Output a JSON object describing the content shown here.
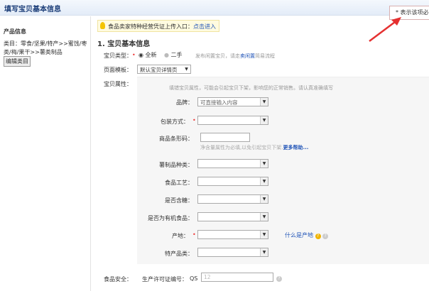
{
  "header": {
    "title": "填写宝贝基本信息"
  },
  "tooltip": {
    "text": "* 表示该项必"
  },
  "sidebar": {
    "heading": "产品信息",
    "category_line1": "类目：零食/坚果/特产>>蜜饯/枣",
    "category_line2": "类/梅/果干>>薯类制品",
    "edit_button": "编辑类目"
  },
  "notice": {
    "text": "食品卖家特种经营凭证上传入口：",
    "link": "点击进入"
  },
  "section": {
    "title": "1. 宝贝基本信息"
  },
  "type": {
    "label": "宝贝类型：",
    "opt_new": "全新",
    "opt_used": "二手",
    "hint": "发布闲置宝贝，请走",
    "hint_link": "卖闲置",
    "hint_tail": "简易流程"
  },
  "template": {
    "label": "页面模板：",
    "value": "默认宝贝详情页"
  },
  "attrs": {
    "label": "宝贝属性：",
    "hint": "填错宝贝属性，可能会引起宝贝下架，影响您的正常销售。请认真准确填写",
    "brand_label": "品牌：",
    "brand_placeholder": "可直接输入内容",
    "pack_label": "包装方式：",
    "barcode_label": "商品条形码：",
    "barcode_hint": "净含量属性为必填,以免引起宝贝下架.",
    "barcode_help": "更多帮助...",
    "kind_label": "薯制品种类：",
    "craft_label": "食品工艺：",
    "sugar_label": "是否含糖：",
    "organic_label": "是否为有机食品：",
    "origin_label": "产地：",
    "origin_help": "什么是产地",
    "special_label": "特产品类："
  },
  "food": {
    "label": "食品安全：",
    "license_label": "生产许可证编号：",
    "prefix": "QS",
    "value": "12"
  }
}
